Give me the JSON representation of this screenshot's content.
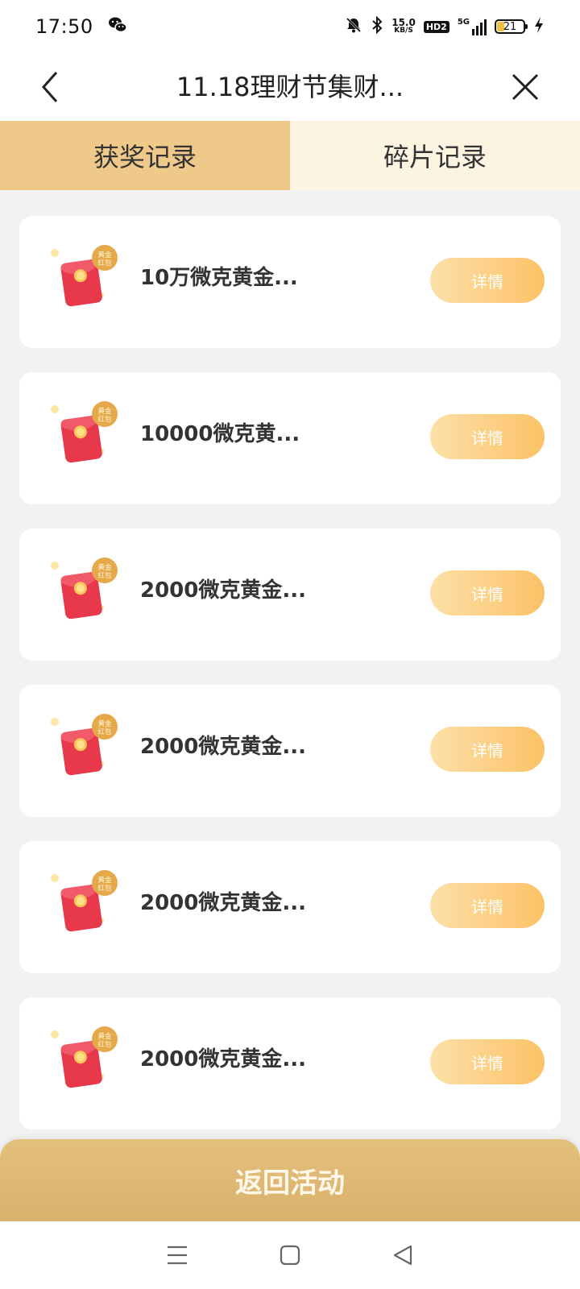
{
  "status_bar": {
    "time": "17:50",
    "net_speed_value": "15.0",
    "net_speed_unit": "KB/S",
    "hd_label": "HD2",
    "network_label": "5G",
    "battery_level": "21"
  },
  "header": {
    "title": "11.18理财节集财..."
  },
  "tabs": [
    {
      "label": "获奖记录",
      "active": true
    },
    {
      "label": "碎片记录",
      "active": false
    }
  ],
  "records": [
    {
      "title": "10万微克黄金...",
      "badge_line1": "黄金",
      "badge_line2": "红包",
      "button": "详情"
    },
    {
      "title": "10000微克黄...",
      "badge_line1": "黄金",
      "badge_line2": "红包",
      "button": "详情"
    },
    {
      "title": "2000微克黄金...",
      "badge_line1": "黄金",
      "badge_line2": "红包",
      "button": "详情"
    },
    {
      "title": "2000微克黄金...",
      "badge_line1": "黄金",
      "badge_line2": "红包",
      "button": "详情"
    },
    {
      "title": "2000微克黄金...",
      "badge_line1": "黄金",
      "badge_line2": "红包",
      "button": "详情"
    },
    {
      "title": "2000微克黄金...",
      "badge_line1": "黄金",
      "badge_line2": "红包",
      "button": "详情"
    }
  ],
  "footer": {
    "return_label": "返回活动"
  },
  "colors": {
    "tab_active": "#efc98a",
    "tab_inactive": "#fdf3e1",
    "button_gradient_start": "#fde0a8",
    "button_gradient_end": "#fbc266",
    "return_button": "#dcb671",
    "red_packet": "#e8394c"
  },
  "icons": {
    "back": "chevron-left-icon",
    "close": "close-icon",
    "wechat": "wechat-icon",
    "mute": "bell-off-icon",
    "bluetooth": "bluetooth-icon",
    "charging": "lightning-icon",
    "red_packet": "gold-red-packet-icon",
    "nav_menu": "menu-icon",
    "nav_home": "home-square-icon",
    "nav_back": "back-triangle-icon"
  }
}
